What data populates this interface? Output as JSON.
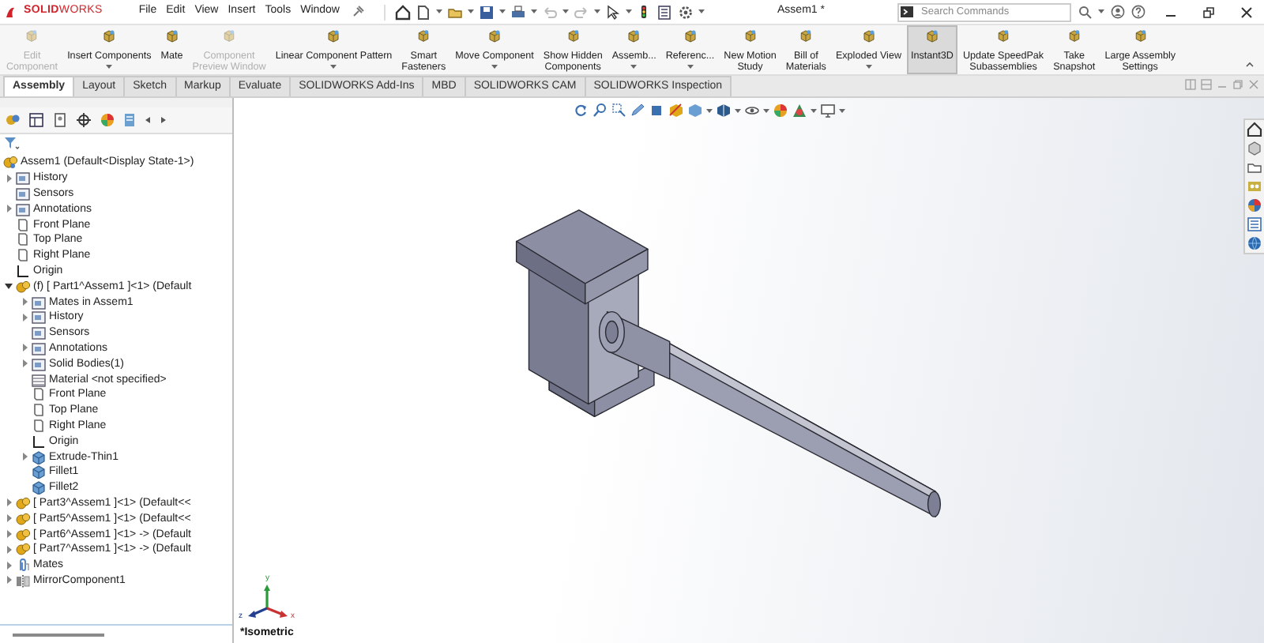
{
  "app": {
    "logo": "**SOLID**WORKS",
    "menu": [
      "File",
      "Edit",
      "View",
      "Insert",
      "Tools",
      "Window"
    ],
    "title": "Assem1 *",
    "search": {
      "placeholder": "Search Commands"
    }
  },
  "ribbon": [
    {
      "label": [
        "Edit",
        "Component"
      ],
      "disabled": true,
      "selected": false,
      "dropdown": false
    },
    {
      "label": [
        "Insert Components"
      ],
      "disabled": false,
      "selected": false,
      "dropdown": true
    },
    {
      "label": [
        "Mate"
      ],
      "disabled": false,
      "selected": false,
      "dropdown": false
    },
    {
      "label": [
        "Component",
        "Preview Window"
      ],
      "disabled": true,
      "selected": false,
      "dropdown": false
    },
    {
      "label": [
        "Linear Component Pattern"
      ],
      "disabled": false,
      "selected": false,
      "dropdown": true
    },
    {
      "label": [
        "Smart",
        "Fasteners"
      ],
      "disabled": false,
      "selected": false,
      "dropdown": false
    },
    {
      "label": [
        "Move Component"
      ],
      "disabled": false,
      "selected": false,
      "dropdown": true
    },
    {
      "label": [
        "Show Hidden",
        "Components"
      ],
      "disabled": false,
      "selected": false,
      "dropdown": false
    },
    {
      "label": [
        "Assemb..."
      ],
      "disabled": false,
      "selected": false,
      "dropdown": true
    },
    {
      "label": [
        "Referenc..."
      ],
      "disabled": false,
      "selected": false,
      "dropdown": true
    },
    {
      "label": [
        "New Motion",
        "Study"
      ],
      "disabled": false,
      "selected": false,
      "dropdown": false
    },
    {
      "label": [
        "Bill of",
        "Materials"
      ],
      "disabled": false,
      "selected": false,
      "dropdown": false
    },
    {
      "label": [
        "Exploded View"
      ],
      "disabled": false,
      "selected": false,
      "dropdown": true
    },
    {
      "label": [
        "Instant3D"
      ],
      "disabled": false,
      "selected": true,
      "dropdown": false
    },
    {
      "label": [
        "Update SpeedPak",
        "Subassemblies"
      ],
      "disabled": false,
      "selected": false,
      "dropdown": false
    },
    {
      "label": [
        "Take",
        "Snapshot"
      ],
      "disabled": false,
      "selected": false,
      "dropdown": false
    },
    {
      "label": [
        "Large Assembly",
        "Settings"
      ],
      "disabled": false,
      "selected": false,
      "dropdown": false
    }
  ],
  "tabs": [
    {
      "label": "Assembly",
      "selected": true
    },
    {
      "label": "Layout",
      "selected": false
    },
    {
      "label": "Sketch",
      "selected": false
    },
    {
      "label": "Markup",
      "selected": false
    },
    {
      "label": "Evaluate",
      "selected": false
    },
    {
      "label": "SOLIDWORKS Add-Ins",
      "selected": false
    },
    {
      "label": "MBD",
      "selected": false
    },
    {
      "label": "SOLIDWORKS CAM",
      "selected": false
    },
    {
      "label": "SOLIDWORKS Inspection",
      "selected": false
    }
  ],
  "tree": [
    {
      "label": "Assem1  (Default<Display State-1>)",
      "kind": "assembly",
      "children": [
        {
          "label": "History",
          "kind": "folder",
          "expanded": false
        },
        {
          "label": "Sensors",
          "kind": "folder"
        },
        {
          "label": "Annotations",
          "kind": "folder",
          "expanded": false
        },
        {
          "label": "Front Plane",
          "kind": "plane"
        },
        {
          "label": "Top Plane",
          "kind": "plane"
        },
        {
          "label": "Right Plane",
          "kind": "plane"
        },
        {
          "label": "Origin",
          "kind": "origin"
        },
        {
          "label": "(f) [ Part1^Assem1 ]<1> (Default",
          "kind": "part",
          "expanded": true,
          "children": [
            {
              "label": "Mates in Assem1",
              "kind": "folder",
              "expanded": false
            },
            {
              "label": "History",
              "kind": "folder",
              "expanded": false
            },
            {
              "label": "Sensors",
              "kind": "folder"
            },
            {
              "label": "Annotations",
              "kind": "folder",
              "expanded": false
            },
            {
              "label": "Solid Bodies(1)",
              "kind": "folder",
              "expanded": false
            },
            {
              "label": "Material <not specified>",
              "kind": "material"
            },
            {
              "label": "Front Plane",
              "kind": "plane"
            },
            {
              "label": "Top Plane",
              "kind": "plane"
            },
            {
              "label": "Right Plane",
              "kind": "plane"
            },
            {
              "label": "Origin",
              "kind": "origin"
            },
            {
              "label": "Extrude-Thin1",
              "kind": "feature",
              "expanded": false
            },
            {
              "label": "Fillet1",
              "kind": "feature"
            },
            {
              "label": "Fillet2",
              "kind": "feature"
            }
          ]
        },
        {
          "label": "[ Part3^Assem1 ]<1> (Default<<",
          "kind": "part",
          "expanded": false
        },
        {
          "label": "[ Part5^Assem1 ]<1> (Default<<",
          "kind": "part",
          "expanded": false
        },
        {
          "label": "[ Part6^Assem1 ]<1> -> (Default",
          "kind": "part",
          "expanded": false
        },
        {
          "label": "[ Part7^Assem1 ]<1> -> (Default",
          "kind": "part",
          "expanded": false
        },
        {
          "label": "Mates",
          "kind": "mates",
          "expanded": false
        },
        {
          "label": "MirrorComponent1",
          "kind": "mirror",
          "expanded": false
        }
      ]
    }
  ],
  "viewport": {
    "triad_labels": [
      "y",
      "x",
      "z"
    ],
    "view_name": "*Isometric"
  }
}
